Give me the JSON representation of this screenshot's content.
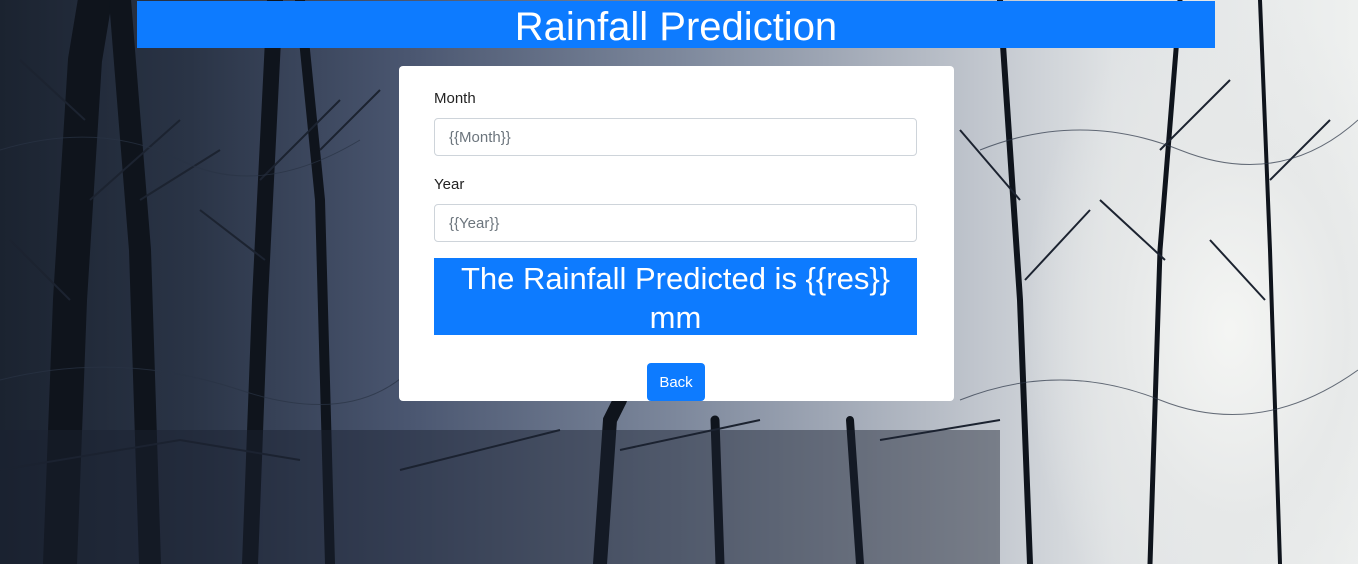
{
  "header": {
    "title": "Rainfall Prediction"
  },
  "form": {
    "month_label": "Month",
    "month_value": "{{Month}}",
    "year_label": "Year",
    "year_value": "{{Year}}"
  },
  "result": {
    "text": "The Rainfall Predicted is {{res}} mm"
  },
  "actions": {
    "back_label": "Back"
  },
  "colors": {
    "accent": "#0d7bff",
    "card": "#ffffff"
  }
}
